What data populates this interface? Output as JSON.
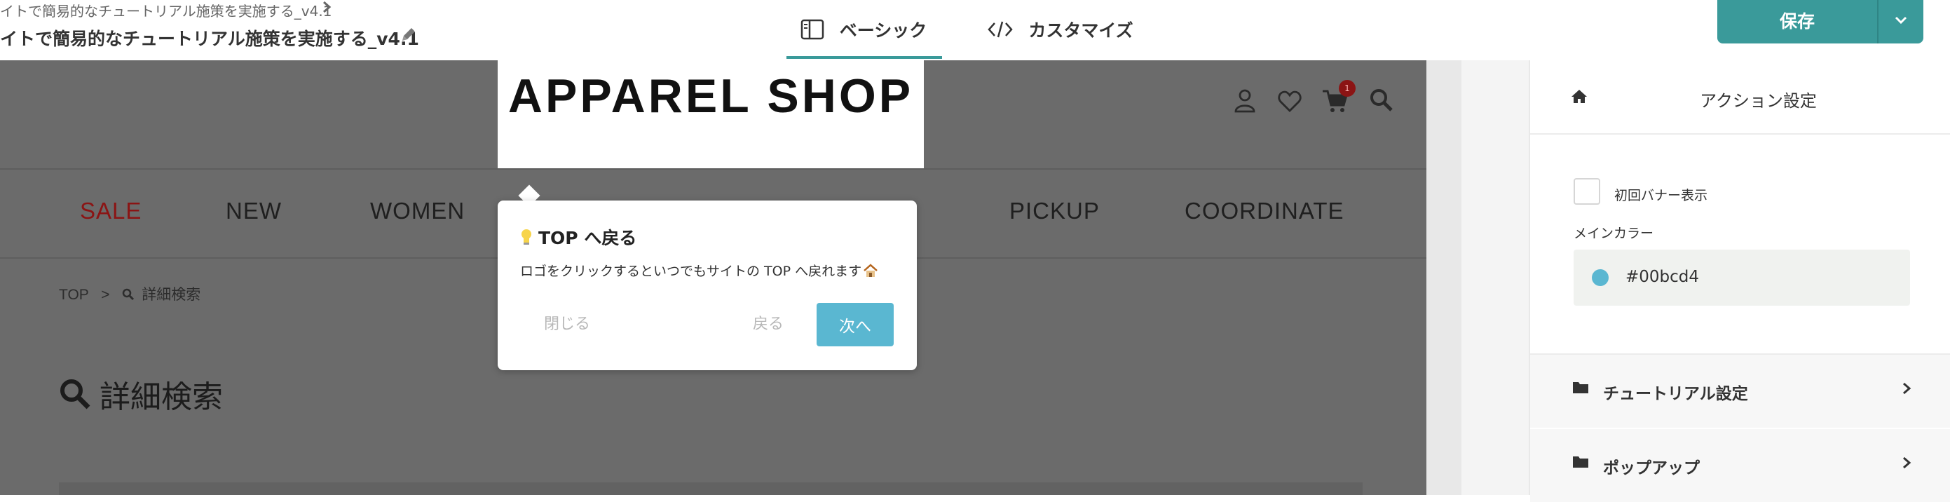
{
  "header": {
    "breadcrumb": "イトで簡易的なチュートリアル施策を実施する_v4.1",
    "project_title": "イトで簡易的なチュートリアル施策を実施する_v4.1",
    "tabs": [
      {
        "label": "ベーシック",
        "icon": "sidebar-layout-icon",
        "active": true
      },
      {
        "label": "カスタマイズ",
        "icon": "code-icon",
        "active": false
      }
    ],
    "save_label": "保存",
    "accent_color": "#3a9a9a"
  },
  "preview": {
    "logo_text": "APPAREL SHOP",
    "cart_badge": "1",
    "nav_items": [
      "SALE",
      "NEW",
      "WOMEN",
      "PICKUP",
      "COORDINATE"
    ],
    "breadcrumb_top": "TOP",
    "breadcrumb_sep": ">",
    "breadcrumb_current": "詳細検索",
    "page_title": "詳細検索"
  },
  "popup": {
    "title": "TOP へ戻る",
    "body": "ロゴをクリックするといつでもサイトの TOP へ戻れます",
    "close_label": "閉じる",
    "back_label": "戻る",
    "next_label": "次へ",
    "button_color": "#5ab7d1"
  },
  "panel": {
    "title": "アクション設定",
    "checkbox_label": "初回バナー表示",
    "main_color_label": "メインカラー",
    "main_color_value": "#00bcd4",
    "sections": [
      "チュートリアル設定",
      "ポップアップ"
    ]
  }
}
